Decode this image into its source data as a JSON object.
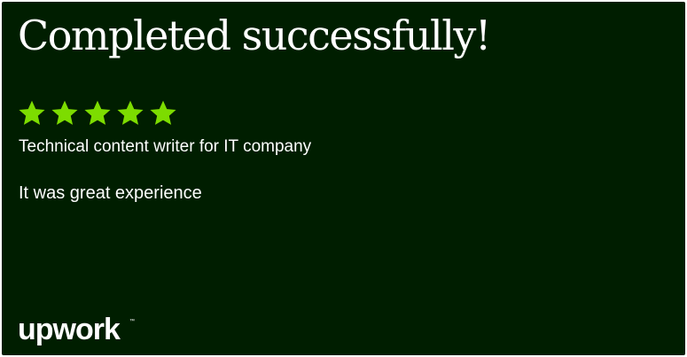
{
  "heading": "Completed successfully!",
  "rating": {
    "stars": 5,
    "max": 5,
    "color": "#7ddc00"
  },
  "job_title": "Technical content writer for IT company",
  "feedback": "It was great experience",
  "brand": {
    "logo_text": "upwork",
    "logo_color": "#ffffff",
    "background": "#001e00"
  }
}
